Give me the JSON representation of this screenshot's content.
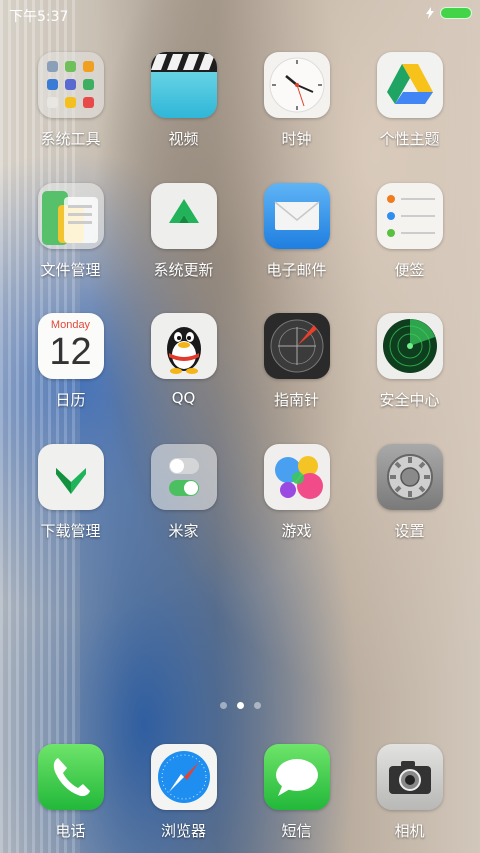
{
  "status_bar": {
    "time": "下午5:37",
    "battery_color": "#44d44a"
  },
  "apps": [
    {
      "id": "tools",
      "label": "系统工具",
      "icon": "folder-icon"
    },
    {
      "id": "video",
      "label": "视频",
      "icon": "clapperboard-icon"
    },
    {
      "id": "clock",
      "label": "时钟",
      "icon": "clock-icon"
    },
    {
      "id": "theme",
      "label": "个性主题",
      "icon": "drive-triangle-icon"
    },
    {
      "id": "files",
      "label": "文件管理",
      "icon": "folder-files-icon"
    },
    {
      "id": "update",
      "label": "系统更新",
      "icon": "up-arrow-icon"
    },
    {
      "id": "mail",
      "label": "电子邮件",
      "icon": "envelope-icon"
    },
    {
      "id": "notes",
      "label": "便签",
      "icon": "list-icon"
    },
    {
      "id": "calendar",
      "label": "日历",
      "icon": "calendar-icon",
      "month": "Monday",
      "day": "12"
    },
    {
      "id": "qq",
      "label": "QQ",
      "icon": "penguin-icon"
    },
    {
      "id": "compass",
      "label": "指南针",
      "icon": "compass-icon"
    },
    {
      "id": "security",
      "label": "安全中心",
      "icon": "radar-icon"
    },
    {
      "id": "download",
      "label": "下载管理",
      "icon": "download-arrow-icon"
    },
    {
      "id": "mijia",
      "label": "米家",
      "icon": "toggle-icon"
    },
    {
      "id": "games",
      "label": "游戏",
      "icon": "bubbles-icon"
    },
    {
      "id": "settings",
      "label": "设置",
      "icon": "gear-icon"
    }
  ],
  "dock": [
    {
      "id": "phone",
      "label": "电话",
      "icon": "phone-icon"
    },
    {
      "id": "browser",
      "label": "浏览器",
      "icon": "compass-safari-icon"
    },
    {
      "id": "sms",
      "label": "短信",
      "icon": "speech-bubble-icon"
    },
    {
      "id": "camera",
      "label": "相机",
      "icon": "camera-icon"
    }
  ],
  "pager": {
    "pages": 3,
    "active": 2
  }
}
